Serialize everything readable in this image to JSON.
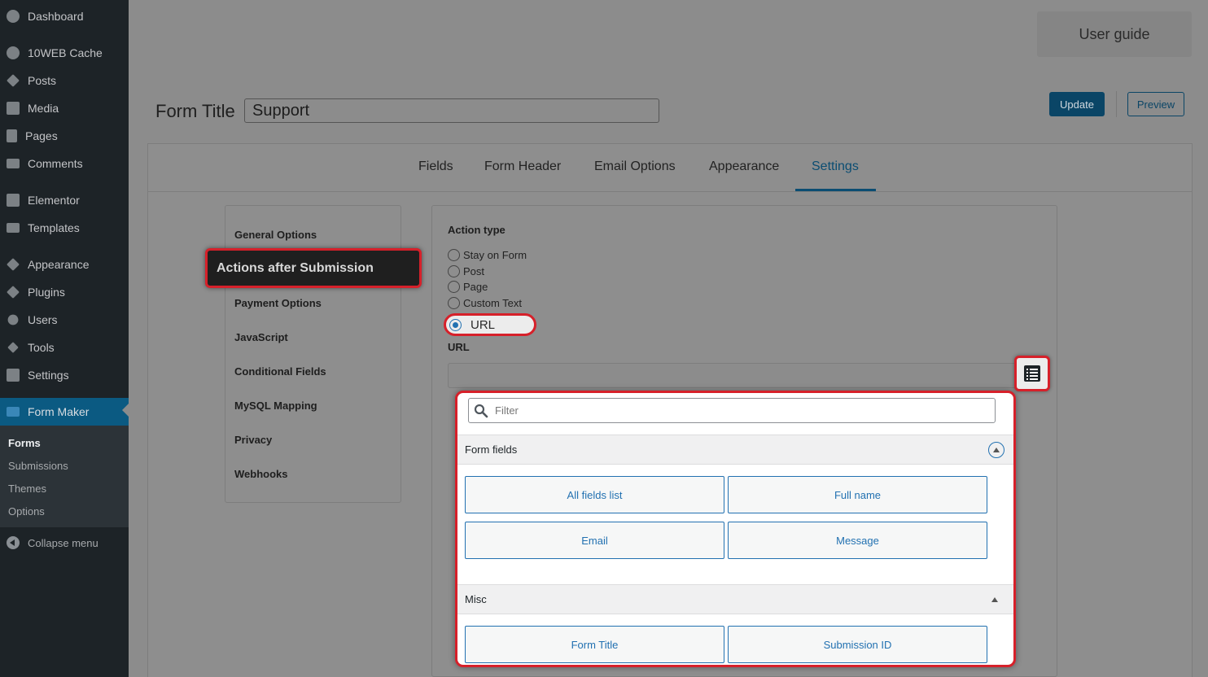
{
  "sidebar": {
    "items": [
      {
        "label": "Dashboard",
        "icon": "dashboard-icon"
      },
      {
        "label": "10WEB Cache",
        "icon": "cache-icon"
      },
      {
        "label": "Posts",
        "icon": "pin-icon"
      },
      {
        "label": "Media",
        "icon": "media-icon"
      },
      {
        "label": "Pages",
        "icon": "pages-icon"
      },
      {
        "label": "Comments",
        "icon": "comments-icon"
      },
      {
        "label": "Elementor",
        "icon": "elementor-icon"
      },
      {
        "label": "Templates",
        "icon": "folder-icon"
      },
      {
        "label": "Appearance",
        "icon": "brush-icon"
      },
      {
        "label": "Plugins",
        "icon": "plugin-icon"
      },
      {
        "label": "Users",
        "icon": "user-icon"
      },
      {
        "label": "Tools",
        "icon": "wrench-icon"
      },
      {
        "label": "Settings",
        "icon": "settings-icon"
      },
      {
        "label": "Form Maker",
        "icon": "form-maker-icon"
      }
    ],
    "submenu": [
      "Forms",
      "Submissions",
      "Themes",
      "Options"
    ],
    "collapse_label": "Collapse menu"
  },
  "header": {
    "user_guide": "User guide",
    "form_title_label": "Form Title",
    "form_title_value": "Support",
    "update": "Update",
    "preview": "Preview"
  },
  "tabs": [
    "Fields",
    "Form Header",
    "Email Options",
    "Appearance",
    "Settings"
  ],
  "active_tab": "Settings",
  "settings_menu": [
    "General Options",
    "Actions after Submission",
    "Payment Options",
    "JavaScript",
    "Conditional Fields",
    "MySQL Mapping",
    "Privacy",
    "Webhooks"
  ],
  "action": {
    "title": "Action type",
    "options": [
      "Stay on Form",
      "Post",
      "Page",
      "Custom Text",
      "URL"
    ],
    "selected": "URL",
    "url_label": "URL",
    "url_value": ""
  },
  "popup": {
    "filter_placeholder": "Filter",
    "sections": [
      {
        "title": "Form fields",
        "buttons": [
          "All fields list",
          "Full name",
          "Email",
          "Message"
        ]
      },
      {
        "title": "Misc",
        "buttons": [
          "Form Title",
          "Submission ID"
        ]
      }
    ]
  },
  "colors": {
    "highlight": "#d6202a",
    "accent": "#2271b1",
    "sidebar_bg": "#1d2327"
  }
}
